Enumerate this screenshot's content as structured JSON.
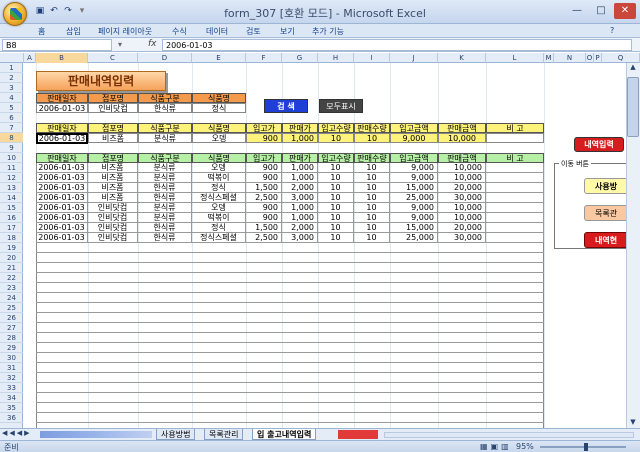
{
  "window": {
    "title": "form_307 [호환 모드] - Microsoft Excel",
    "minimize": "—",
    "maximize": "□",
    "close": "✕"
  },
  "ribbon": {
    "tabs": [
      "홈",
      "삽입",
      "페이지 레이아웃",
      "수식",
      "데이터",
      "검토",
      "보기",
      "추가 기능"
    ]
  },
  "formula_bar": {
    "name_box": "B8",
    "fx": "fx",
    "value": "2006-01-03"
  },
  "columns": [
    "A",
    "B",
    "C",
    "D",
    "E",
    "F",
    "G",
    "H",
    "I",
    "J",
    "K",
    "L",
    "M",
    "N",
    "O",
    "P",
    "Q"
  ],
  "rows": [
    "1",
    "2",
    "3",
    "4",
    "5",
    "6",
    "7",
    "8",
    "9",
    "10",
    "11",
    "12",
    "13",
    "14",
    "15",
    "16",
    "17",
    "18",
    "19",
    "20",
    "21",
    "22",
    "23",
    "24",
    "25",
    "26",
    "27",
    "28",
    "29",
    "30",
    "31",
    "32",
    "33",
    "34",
    "35",
    "36"
  ],
  "title_banner": "판매내역입력",
  "search": {
    "headers": [
      "판매일자",
      "접포명",
      "식품구분",
      "식품명"
    ],
    "values": [
      "2006-01-03",
      "인비닷컴",
      "한식류",
      "정식"
    ]
  },
  "buttons": {
    "search": "검 색",
    "show_all": "모두표시",
    "entry_input": "내역입력",
    "usage": "사용방",
    "catalog": "목록관",
    "history": "내역현"
  },
  "move_label": "이동 버튼",
  "input_row": {
    "headers": [
      "판매일자",
      "접포명",
      "식품구분",
      "식품명",
      "입고가",
      "판매가",
      "입고수량",
      "판매수량",
      "입고금액",
      "판매금액",
      "비 고"
    ],
    "values": [
      "2006-01-03",
      "비즈폼",
      "분식류",
      "오뎅",
      "900",
      "1,000",
      "10",
      "10",
      "9,000",
      "10,000",
      ""
    ]
  },
  "list": {
    "headers": [
      "판매일자",
      "접포명",
      "식품구분",
      "식품명",
      "입고가",
      "판매가",
      "입고수량",
      "판매수량",
      "입고금액",
      "판매금액",
      "비 고"
    ],
    "rows": [
      [
        "2006-01-03",
        "비즈폼",
        "분식류",
        "오뎅",
        "900",
        "1,000",
        "10",
        "10",
        "9,000",
        "10,000",
        ""
      ],
      [
        "2006-01-03",
        "비즈폼",
        "분식류",
        "떡볶이",
        "900",
        "1,000",
        "10",
        "10",
        "9,000",
        "10,000",
        ""
      ],
      [
        "2006-01-03",
        "비즈폼",
        "한식류",
        "정식",
        "1,500",
        "2,000",
        "10",
        "10",
        "15,000",
        "20,000",
        ""
      ],
      [
        "2006-01-03",
        "비즈폼",
        "한식류",
        "정식스페셜",
        "2,500",
        "3,000",
        "10",
        "10",
        "25,000",
        "30,000",
        ""
      ],
      [
        "2006-01-03",
        "인비닷컴",
        "분식류",
        "오뎅",
        "900",
        "1,000",
        "10",
        "10",
        "9,000",
        "10,000",
        ""
      ],
      [
        "2006-01-03",
        "인비닷컴",
        "분식류",
        "떡볶이",
        "900",
        "1,000",
        "10",
        "10",
        "9,000",
        "10,000",
        ""
      ],
      [
        "2006-01-03",
        "인비닷컴",
        "한식류",
        "정식",
        "1,500",
        "2,000",
        "10",
        "10",
        "15,000",
        "20,000",
        ""
      ],
      [
        "2006-01-03",
        "인비닷컴",
        "한식류",
        "정식스페셜",
        "2,500",
        "3,000",
        "10",
        "10",
        "25,000",
        "30,000",
        ""
      ]
    ]
  },
  "sheet_tabs": [
    "사용방법",
    "목록관리",
    "입 출고내역입력"
  ],
  "status": {
    "ready": "준비",
    "zoom": "95%"
  }
}
